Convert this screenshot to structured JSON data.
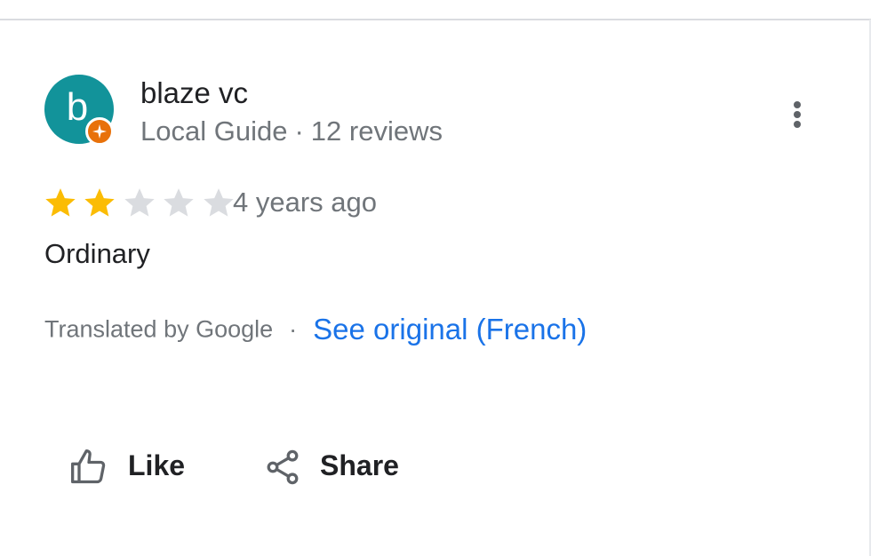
{
  "review": {
    "reviewer": {
      "avatar_letter": "b",
      "avatar_color": "#12939a",
      "badge_icon": "local-guide-star-icon",
      "badge_color": "#e8710a",
      "name": "blaze vc",
      "guide_label": "Local Guide",
      "separator": "·",
      "reviews_count": "12 reviews"
    },
    "more_icon": "more-vert-icon",
    "rating": {
      "value": 2,
      "max": 5,
      "filled_color": "#fbbc04",
      "empty_color": "#dadce0"
    },
    "time": "4 years ago",
    "text": "Ordinary",
    "translation": {
      "translated_by": "Translated by Google",
      "separator": "·",
      "see_original": "See original (French)",
      "link_color": "#1a73e8"
    },
    "actions": {
      "like": {
        "icon": "thumb-up-icon",
        "label": "Like"
      },
      "share": {
        "icon": "share-icon",
        "label": "Share"
      }
    }
  }
}
